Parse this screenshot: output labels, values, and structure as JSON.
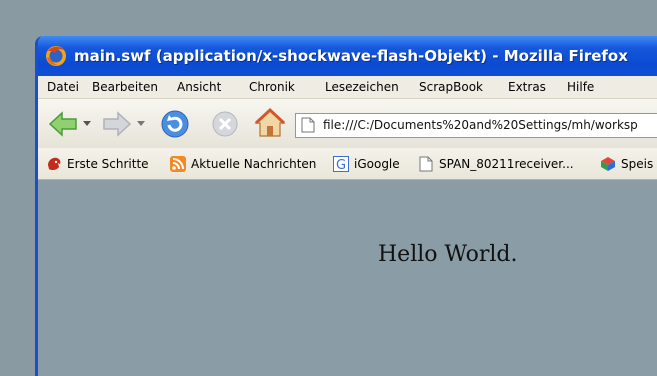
{
  "window": {
    "title": "main.swf (application/x-shockwave-flash-Objekt) - Mozilla Firefox"
  },
  "menu": {
    "items": [
      {
        "label": "Datei"
      },
      {
        "label": "Bearbeiten"
      },
      {
        "label": "Ansicht"
      },
      {
        "label": "Chronik"
      },
      {
        "label": "Lesezeichen"
      },
      {
        "label": "ScrapBook"
      },
      {
        "label": "Extras"
      },
      {
        "label": "Hilfe"
      }
    ]
  },
  "toolbar": {
    "url": "file:///C:/Documents%20and%20Settings/mh/worksp"
  },
  "bookmarks": [
    {
      "label": "Erste Schritte",
      "icon": "firefox-bookmark-icon"
    },
    {
      "label": "Aktuelle Nachrichten",
      "icon": "rss-feed-icon"
    },
    {
      "label": "iGoogle",
      "icon": "google-icon"
    },
    {
      "label": "SPAN_80211receiver...",
      "icon": "page-icon"
    },
    {
      "label": "Speis",
      "icon": "colored-cube-icon"
    }
  ],
  "content": {
    "text": "Hello World."
  },
  "colors": {
    "titlebar": "#0a4bd2",
    "content_bg": "#8a9ca6",
    "desktop_bg": "#8a9aa3"
  }
}
